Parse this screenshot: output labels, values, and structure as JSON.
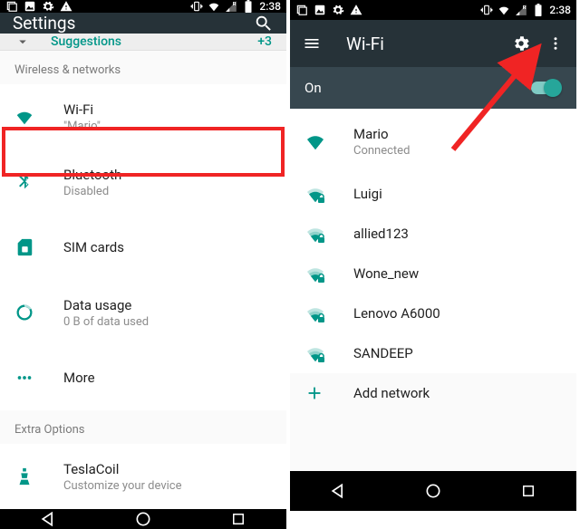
{
  "status": {
    "time": "2:38"
  },
  "left": {
    "appbar_title": "Settings",
    "suggestions_label": "Suggestions",
    "suggestions_count": "+3",
    "subheader1": "Wireless & networks",
    "wifi": {
      "label": "Wi-Fi",
      "sub": "\"Mario\""
    },
    "bluetooth": {
      "label": "Bluetooth",
      "sub": "Disabled"
    },
    "sim": {
      "label": "SIM cards"
    },
    "data": {
      "label": "Data usage",
      "sub": "0 B of data used"
    },
    "more": {
      "label": "More"
    },
    "subheader2": "Extra Options",
    "tesla": {
      "label": "TeslaCoil",
      "sub": "Customize your device"
    }
  },
  "right": {
    "appbar_title": "Wi-Fi",
    "on_label": "On",
    "networks": [
      {
        "ssid": "Mario",
        "sub": "Connected",
        "strength": 4,
        "lock": false
      },
      {
        "ssid": "Luigi",
        "strength": 3,
        "lock": true
      },
      {
        "ssid": "allied123",
        "strength": 2,
        "lock": true
      },
      {
        "ssid": "Wone_new",
        "strength": 2,
        "lock": true
      },
      {
        "ssid": "Lenovo A6000",
        "strength": 2,
        "lock": true
      },
      {
        "ssid": "SANDEEP",
        "strength": 2,
        "lock": true
      }
    ],
    "add_label": "Add network"
  },
  "colors": {
    "accent": "#009688",
    "toolbar": "#263238",
    "subbar": "#37474f",
    "annotation": "#f02424"
  }
}
